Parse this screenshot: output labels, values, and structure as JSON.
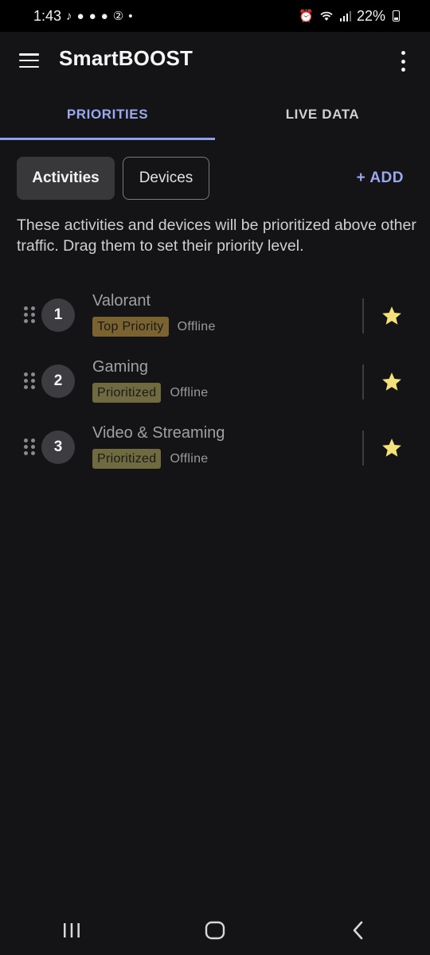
{
  "status_bar": {
    "time": "1:43",
    "notification_icons": [
      "tiktok-icon",
      "reddit-icon",
      "reddit-icon",
      "reddit-icon",
      "badge-2-icon",
      "dot-icon"
    ],
    "battery": "22%"
  },
  "app_bar": {
    "title": "SmartBOOST"
  },
  "tabs": [
    {
      "label": "PRIORITIES",
      "active": true
    },
    {
      "label": "LIVE DATA",
      "active": false
    }
  ],
  "segments": {
    "activities": "Activities",
    "devices": "Devices",
    "add": "+ ADD"
  },
  "description": "These activities and devices will be prioritized above other traffic. Drag them to set their priority level.",
  "priorities": [
    {
      "rank": "1",
      "name": "Valorant",
      "badge": "Top Priority",
      "status": "Offline"
    },
    {
      "rank": "2",
      "name": "Gaming",
      "badge": "Prioritized",
      "status": "Offline"
    },
    {
      "rank": "3",
      "name": "Video & Streaming",
      "badge": "Prioritized",
      "status": "Offline"
    }
  ],
  "colors": {
    "accent": "#9aa9ef",
    "star": "#f4e17a",
    "top_badge": "#7a6330",
    "prio_badge": "#6f6a3f"
  }
}
